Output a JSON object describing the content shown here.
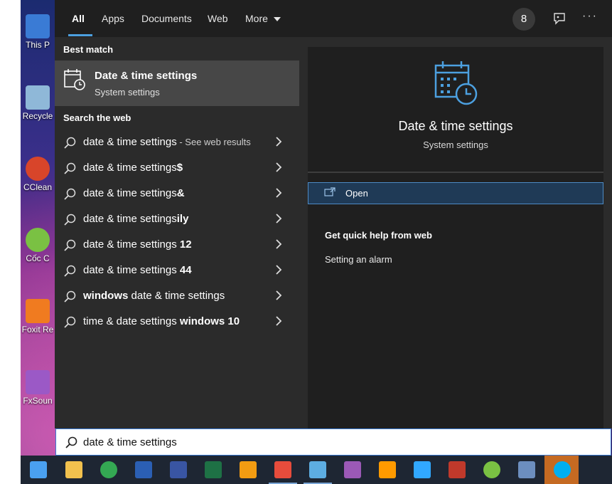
{
  "desktop": {
    "icons": [
      {
        "label": "This P",
        "color": "#3a7bd5"
      },
      {
        "label": "Recycle",
        "color": "#8fb8d8"
      },
      {
        "label": "CClean",
        "color": "#d8452a"
      },
      {
        "label": "Cốc C",
        "color": "#7ac143"
      },
      {
        "label": "Foxit Re",
        "color": "#f07b20"
      },
      {
        "label": "FxSoun",
        "color": "#9b59c6"
      }
    ]
  },
  "topbar": {
    "tabs": [
      {
        "label": "All",
        "active": true
      },
      {
        "label": "Apps"
      },
      {
        "label": "Documents"
      },
      {
        "label": "Web"
      },
      {
        "label": "More"
      }
    ],
    "badge_count": "8"
  },
  "left": {
    "best_match_heading": "Best match",
    "best_match": {
      "title": "Date & time settings",
      "subtitle": "System settings"
    },
    "web_heading": "Search the web",
    "web_results": [
      {
        "normal": "date & time settings",
        "bold": "",
        "suffix": " - See web results"
      },
      {
        "normal": "date & time settings",
        "bold": "$",
        "suffix": ""
      },
      {
        "normal": "date & time settings",
        "bold": "&",
        "suffix": ""
      },
      {
        "normal": "date & time settings",
        "bold": "ily",
        "suffix": ""
      },
      {
        "normal": "date & time settings ",
        "bold": "12",
        "suffix": ""
      },
      {
        "normal": "date & time settings ",
        "bold": "44",
        "suffix": ""
      },
      {
        "prefix_bold": "windows",
        "normal": " date & time settings",
        "bold": "",
        "suffix": ""
      },
      {
        "normal": "time & date settings ",
        "bold": "windows 10",
        "suffix": ""
      }
    ]
  },
  "right": {
    "title": "Date & time settings",
    "subtitle": "System settings",
    "open_label": "Open",
    "quick_help_heading": "Get quick help from web",
    "quick_help_items": [
      "Setting an alarm"
    ]
  },
  "search": {
    "value": "date & time settings"
  },
  "taskbar": {
    "apps": [
      {
        "name": "start-icon",
        "color": "#4aa0f0"
      },
      {
        "name": "file-explorer-icon",
        "color": "#f2c14e"
      },
      {
        "name": "chrome-icon",
        "color": "#34a853"
      },
      {
        "name": "word-icon",
        "color": "#2b5fb4"
      },
      {
        "name": "visio-icon",
        "color": "#3955a3"
      },
      {
        "name": "excel-icon",
        "color": "#1e7145"
      },
      {
        "name": "media-player-icon",
        "color": "#f39c12"
      },
      {
        "name": "paint-icon",
        "color": "#e74c3c"
      },
      {
        "name": "paint-brush-icon",
        "color": "#5dade2"
      },
      {
        "name": "premiere-icon",
        "color": "#9b59b6"
      },
      {
        "name": "illustrator-icon",
        "color": "#ff9a00"
      },
      {
        "name": "photoshop-icon",
        "color": "#31a8ff"
      },
      {
        "name": "game-icon",
        "color": "#c0392b"
      },
      {
        "name": "coc-coc-icon",
        "color": "#7ac143"
      },
      {
        "name": "calculator-icon",
        "color": "#6c8ebf"
      },
      {
        "name": "skype-icon",
        "color": "#00aff0"
      }
    ]
  }
}
